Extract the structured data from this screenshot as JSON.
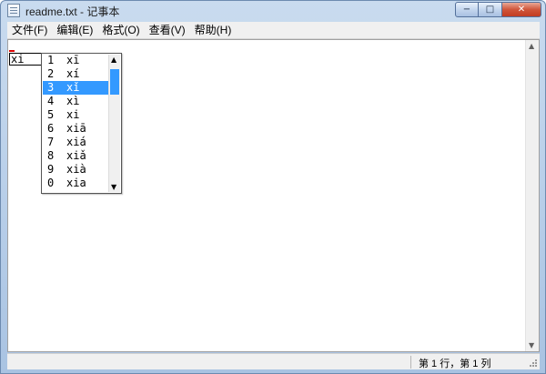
{
  "window": {
    "title": "readme.txt - 记事本"
  },
  "menu": [
    {
      "label": "文件(F)"
    },
    {
      "label": "编辑(E)"
    },
    {
      "label": "格式(O)"
    },
    {
      "label": "查看(V)"
    },
    {
      "label": "帮助(H)"
    }
  ],
  "controls": {
    "minimize": "−",
    "maximize": "□",
    "close": "✕"
  },
  "ime": {
    "composition": "xi",
    "candidates": [
      {
        "num": "1",
        "text": "xī"
      },
      {
        "num": "2",
        "text": "xí"
      },
      {
        "num": "3",
        "text": "xǐ"
      },
      {
        "num": "4",
        "text": "xì"
      },
      {
        "num": "5",
        "text": "xi"
      },
      {
        "num": "6",
        "text": "xiā"
      },
      {
        "num": "7",
        "text": "xiá"
      },
      {
        "num": "8",
        "text": "xiǎ"
      },
      {
        "num": "9",
        "text": "xià"
      },
      {
        "num": "0",
        "text": "xia"
      }
    ],
    "selected_index": 2,
    "arrows": {
      "up": "▲",
      "down": "▼"
    }
  },
  "editor": {
    "arrows": {
      "up": "▲",
      "down": "▼"
    }
  },
  "status": {
    "position": "第 1 行，第 1 列"
  }
}
